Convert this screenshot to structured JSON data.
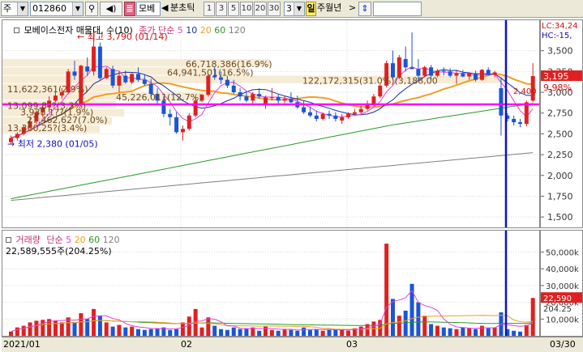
{
  "toolbar": {
    "market_label": "주",
    "stock_code": "012860",
    "stock_name": "모베",
    "period_labels": [
      "분",
      "초",
      "틱"
    ],
    "interval_buttons": [
      "1",
      "3",
      "5",
      "10",
      "20",
      "30"
    ],
    "interval_value": "3",
    "period_day": "일",
    "period_week": "주",
    "period_month": "월",
    "period_year": "년",
    "nav_left": "◀",
    "nav_right": ">",
    "sync_icon": "up-down-arrow-icon"
  },
  "price_panel": {
    "legend_title": "모베이스전자 매물대, 수(10)",
    "ma_label": "종가 단순",
    "ma_periods": [
      "5",
      "10",
      "20",
      "60",
      "120"
    ],
    "ma_colors": [
      "#e040e0",
      "#1a2fa0",
      "#f0a020",
      "#2a9a2a",
      "#808080"
    ],
    "high_note": "최고 3,790 (01/14)",
    "low_note": "최저 2,380 (01/05)",
    "current_price_tag": "3,195",
    "current_pct_tag": "9.98%",
    "lc_label": "LC:34,24",
    "hc_label": "HC:-15,",
    "marker_label": "2,400",
    "volume_profile_labels": [
      "66,718,386(16.9%)",
      "64,941,501(16.5%)",
      "122,172,315(31.0%)(3,188,00",
      "11,622,361(2.9%)",
      "45,226,011(12.7%)",
      "13,099,8??(3.3%)",
      "3,938,1??(1.9%)",
      "27,462,627(7.0%)",
      "13,360,25?(3.4%)"
    ]
  },
  "price_axis": {
    "ticks": [
      "3,500",
      "3,250",
      "3,000",
      "2,750",
      "2,500",
      "2,250",
      "2,000",
      "1,750",
      "1,500"
    ],
    "tag_bg": "#e02020"
  },
  "volume_panel": {
    "legend_title": "거래량",
    "ma_label": "단순",
    "ma_periods": [
      "5",
      "20",
      "60",
      "120"
    ],
    "volume_info": "22,589,555주(204.25%)",
    "current_volume_tag": "22,590",
    "current_pct_tag": "204.25"
  },
  "volume_axis": {
    "ticks": [
      "50,000k",
      "40,000k",
      "30,000k",
      "20,000k",
      "10,000k"
    ]
  },
  "date_bar": {
    "labels": [
      "2021/01",
      "02",
      "03"
    ],
    "right_label": "03/30"
  },
  "chart_data": {
    "type": "candlestick",
    "price_range": [
      1375,
      3750
    ],
    "volume_range": [
      0,
      56000
    ],
    "candles": [
      {
        "o": 2400,
        "h": 2480,
        "l": 2380,
        "c": 2450,
        "v": 2500
      },
      {
        "o": 2450,
        "h": 2520,
        "l": 2420,
        "c": 2500,
        "v": 5000
      },
      {
        "o": 2500,
        "h": 2600,
        "l": 2480,
        "c": 2580,
        "v": 6000
      },
      {
        "o": 2580,
        "h": 2700,
        "l": 2560,
        "c": 2650,
        "v": 8000
      },
      {
        "o": 2650,
        "h": 2780,
        "l": 2620,
        "c": 2760,
        "v": 9000
      },
      {
        "o": 2760,
        "h": 2860,
        "l": 2700,
        "c": 2820,
        "v": 9500
      },
      {
        "o": 2820,
        "h": 2950,
        "l": 2760,
        "c": 2900,
        "v": 10000
      },
      {
        "o": 2900,
        "h": 3000,
        "l": 2880,
        "c": 2960,
        "v": 9000
      },
      {
        "o": 2960,
        "h": 3050,
        "l": 2920,
        "c": 3000,
        "v": 8000
      },
      {
        "o": 3000,
        "h": 3280,
        "l": 2980,
        "c": 3250,
        "v": 11000
      },
      {
        "o": 3250,
        "h": 3380,
        "l": 3150,
        "c": 3200,
        "v": 8000
      },
      {
        "o": 2850,
        "h": 3330,
        "l": 2830,
        "c": 3320,
        "v": 13500
      },
      {
        "o": 3310,
        "h": 3420,
        "l": 3200,
        "c": 3250,
        "v": 10000
      },
      {
        "o": 3250,
        "h": 3790,
        "l": 3200,
        "c": 3550,
        "v": 16000
      },
      {
        "o": 3550,
        "h": 3600,
        "l": 3150,
        "c": 3170,
        "v": 12000
      },
      {
        "o": 3170,
        "h": 3300,
        "l": 3160,
        "c": 3280,
        "v": 8000
      },
      {
        "o": 3280,
        "h": 3320,
        "l": 3050,
        "c": 3080,
        "v": 5500
      },
      {
        "o": 3080,
        "h": 3250,
        "l": 3000,
        "c": 3200,
        "v": 6500
      },
      {
        "o": 3200,
        "h": 3260,
        "l": 3100,
        "c": 3120,
        "v": 5000
      },
      {
        "o": 3120,
        "h": 3230,
        "l": 3100,
        "c": 3220,
        "v": 5500
      },
      {
        "o": 3220,
        "h": 3300,
        "l": 3130,
        "c": 3150,
        "v": 4000
      },
      {
        "o": 3150,
        "h": 3220,
        "l": 3080,
        "c": 3100,
        "v": 3500
      },
      {
        "o": 3100,
        "h": 3160,
        "l": 2950,
        "c": 2980,
        "v": 4000
      },
      {
        "o": 2980,
        "h": 3050,
        "l": 2850,
        "c": 2900,
        "v": 4500
      },
      {
        "o": 2900,
        "h": 2950,
        "l": 2700,
        "c": 2740,
        "v": 5000
      },
      {
        "o": 2740,
        "h": 2800,
        "l": 2600,
        "c": 2700,
        "v": 3500
      },
      {
        "o": 2700,
        "h": 2760,
        "l": 2500,
        "c": 2520,
        "v": 4000
      },
      {
        "o": 2520,
        "h": 2600,
        "l": 2420,
        "c": 2560,
        "v": 8000
      },
      {
        "o": 2560,
        "h": 2750,
        "l": 2540,
        "c": 2720,
        "v": 11500
      },
      {
        "o": 2720,
        "h": 2950,
        "l": 2700,
        "c": 2900,
        "v": 16000
      },
      {
        "o": 2900,
        "h": 2980,
        "l": 2880,
        "c": 2970,
        "v": 5000
      },
      {
        "o": 2970,
        "h": 3220,
        "l": 2950,
        "c": 3200,
        "v": 11000
      },
      {
        "o": 3200,
        "h": 3300,
        "l": 3150,
        "c": 3180,
        "v": 6000
      },
      {
        "o": 3180,
        "h": 3250,
        "l": 3100,
        "c": 3150,
        "v": 4000
      },
      {
        "o": 3150,
        "h": 3200,
        "l": 3050,
        "c": 3080,
        "v": 3500
      },
      {
        "o": 3080,
        "h": 3150,
        "l": 2980,
        "c": 3000,
        "v": 5000
      },
      {
        "o": 3000,
        "h": 3050,
        "l": 2900,
        "c": 2950,
        "v": 4000
      },
      {
        "o": 2950,
        "h": 3000,
        "l": 2880,
        "c": 2900,
        "v": 4500
      },
      {
        "o": 2900,
        "h": 3000,
        "l": 2850,
        "c": 2980,
        "v": 5000
      },
      {
        "o": 2980,
        "h": 3050,
        "l": 2920,
        "c": 2950,
        "v": 3000
      },
      {
        "o": 2850,
        "h": 2960,
        "l": 2800,
        "c": 2940,
        "v": 5500
      },
      {
        "o": 2940,
        "h": 3050,
        "l": 2900,
        "c": 2940,
        "v": 3500
      },
      {
        "o": 2940,
        "h": 2980,
        "l": 2850,
        "c": 2900,
        "v": 3000
      },
      {
        "o": 2900,
        "h": 2960,
        "l": 2870,
        "c": 2920,
        "v": 4000
      },
      {
        "o": 2920,
        "h": 3000,
        "l": 2870,
        "c": 2880,
        "v": 3500
      },
      {
        "o": 2880,
        "h": 2960,
        "l": 2800,
        "c": 2820,
        "v": 3000
      },
      {
        "o": 2820,
        "h": 2900,
        "l": 2740,
        "c": 2760,
        "v": 5000
      },
      {
        "o": 2760,
        "h": 2830,
        "l": 2700,
        "c": 2720,
        "v": 3500
      },
      {
        "o": 2720,
        "h": 2780,
        "l": 2650,
        "c": 2680,
        "v": 4000
      },
      {
        "o": 2680,
        "h": 2760,
        "l": 2660,
        "c": 2740,
        "v": 3000
      },
      {
        "o": 2740,
        "h": 2780,
        "l": 2680,
        "c": 2720,
        "v": 3500
      },
      {
        "o": 2720,
        "h": 2760,
        "l": 2650,
        "c": 2680,
        "v": 4000
      },
      {
        "o": 2660,
        "h": 2740,
        "l": 2620,
        "c": 2700,
        "v": 3500
      },
      {
        "o": 2700,
        "h": 2760,
        "l": 2680,
        "c": 2740,
        "v": 3000
      },
      {
        "o": 2740,
        "h": 2800,
        "l": 2720,
        "c": 2760,
        "v": 4500
      },
      {
        "o": 2760,
        "h": 2840,
        "l": 2740,
        "c": 2800,
        "v": 5500
      },
      {
        "o": 2800,
        "h": 2900,
        "l": 2780,
        "c": 2850,
        "v": 7000
      },
      {
        "o": 2850,
        "h": 2980,
        "l": 2830,
        "c": 2950,
        "v": 8500
      },
      {
        "o": 2950,
        "h": 3100,
        "l": 2930,
        "c": 3080,
        "v": 9500
      },
      {
        "o": 3080,
        "h": 3380,
        "l": 3060,
        "c": 3350,
        "v": 55000
      },
      {
        "o": 3350,
        "h": 3500,
        "l": 3150,
        "c": 3180,
        "v": 22000
      },
      {
        "o": 3180,
        "h": 3450,
        "l": 3160,
        "c": 3420,
        "v": 12000
      },
      {
        "o": 3400,
        "h": 3550,
        "l": 3250,
        "c": 3300,
        "v": 15000
      },
      {
        "o": 3300,
        "h": 3720,
        "l": 3280,
        "c": 3280,
        "v": 31000
      },
      {
        "o": 3280,
        "h": 3400,
        "l": 3150,
        "c": 3200,
        "v": 20000
      },
      {
        "o": 3200,
        "h": 3320,
        "l": 3180,
        "c": 3300,
        "v": 12000
      },
      {
        "o": 3300,
        "h": 3330,
        "l": 3150,
        "c": 3200,
        "v": 7000
      },
      {
        "o": 3200,
        "h": 3280,
        "l": 3180,
        "c": 3260,
        "v": 6000
      },
      {
        "o": 3260,
        "h": 3300,
        "l": 3200,
        "c": 3250,
        "v": 5000
      },
      {
        "o": 3250,
        "h": 3290,
        "l": 3180,
        "c": 3200,
        "v": 4500
      },
      {
        "o": 3200,
        "h": 3260,
        "l": 3100,
        "c": 3230,
        "v": 4000
      },
      {
        "o": 3230,
        "h": 3270,
        "l": 3180,
        "c": 3190,
        "v": 5000
      },
      {
        "o": 3190,
        "h": 3240,
        "l": 3150,
        "c": 3230,
        "v": 4500
      },
      {
        "o": 3230,
        "h": 3260,
        "l": 3130,
        "c": 3150,
        "v": 4000
      },
      {
        "o": 3150,
        "h": 3280,
        "l": 3140,
        "c": 3270,
        "v": 6000
      },
      {
        "o": 3270,
        "h": 3300,
        "l": 3200,
        "c": 3210,
        "v": 4500
      },
      {
        "o": 3210,
        "h": 3260,
        "l": 3180,
        "c": 3240,
        "v": 5000
      },
      {
        "o": 3050,
        "h": 3180,
        "l": 2480,
        "c": 2720,
        "v": 14000
      },
      {
        "o": 2720,
        "h": 2750,
        "l": 2650,
        "c": 2680,
        "v": 4000
      },
      {
        "o": 2680,
        "h": 2720,
        "l": 2600,
        "c": 2640,
        "v": 3000
      },
      {
        "o": 2640,
        "h": 2680,
        "l": 2580,
        "c": 2620,
        "v": 2500
      },
      {
        "o": 2620,
        "h": 2900,
        "l": 2590,
        "c": 2880,
        "v": 6500
      },
      {
        "o": 2900,
        "h": 3350,
        "l": 2880,
        "c": 3195,
        "v": 22590
      }
    ]
  }
}
